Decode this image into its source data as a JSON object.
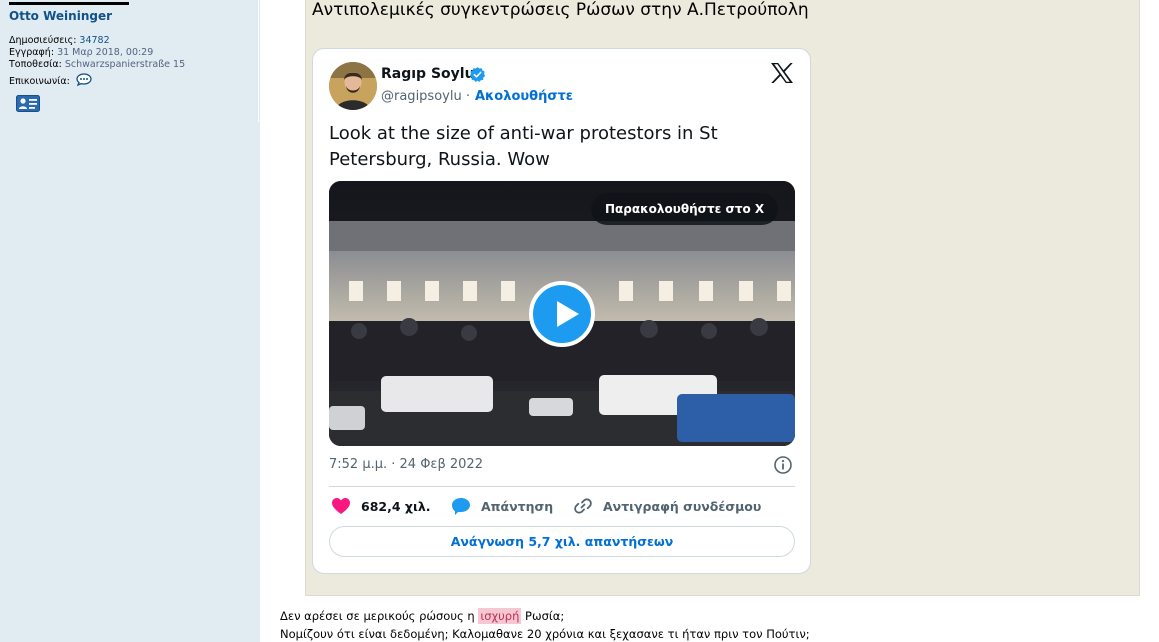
{
  "profile": {
    "username": "Otto Weininger",
    "posts_label": "Δημοσιεύσεις:",
    "posts_value": "34782",
    "joined_label": "Εγγραφή:",
    "joined_value": "31 Μαρ 2018, 00:29",
    "location_label": "Τοποθεσία:",
    "location_value": "Schwarzspanierstraße 15",
    "contact_label": "Επικοινωνία:"
  },
  "post": {
    "title": "Αντιπολεμικές συγκεντρώσεις Ρώσων στην Α.Πετρούπολη",
    "line1_before": "Δεν αρέσει σε μερικούς ρώσους η ",
    "line1_highlight": "ισχυρή",
    "line1_after": " Ρωσία;",
    "line2": "Νομίζουν ότι είναι δεδομένη; Καλομαθανε 20 χρόνια και ξεχασανε τι ήταν πριν τον Πούτιν;"
  },
  "tweet": {
    "author_name": "Ragıp Soylu",
    "author_handle": "@ragipsoylu ·",
    "follow_label": "Ακολουθήστε",
    "text": "Look at the size of anti-war protestors in St Petersburg, Russia. Wow",
    "watch_label": "Παρακολουθήστε στο X",
    "timestamp": "7:52 μ.μ. · 24 Φεβ 2022",
    "likes_count": "682,4 χιλ.",
    "reply_label": "Απάντηση",
    "copy_link_label": "Αντιγραφή συνδέσμου",
    "read_replies_label": "Ανάγνωση 5,7 χιλ. απαντήσεων"
  },
  "colors": {
    "profile_bg": "#e1ebf2",
    "quote_bg": "#ebeadd",
    "link_blue": "#006fd6",
    "like_pink": "#f91880",
    "twitter_blue": "#1d9bf0"
  }
}
